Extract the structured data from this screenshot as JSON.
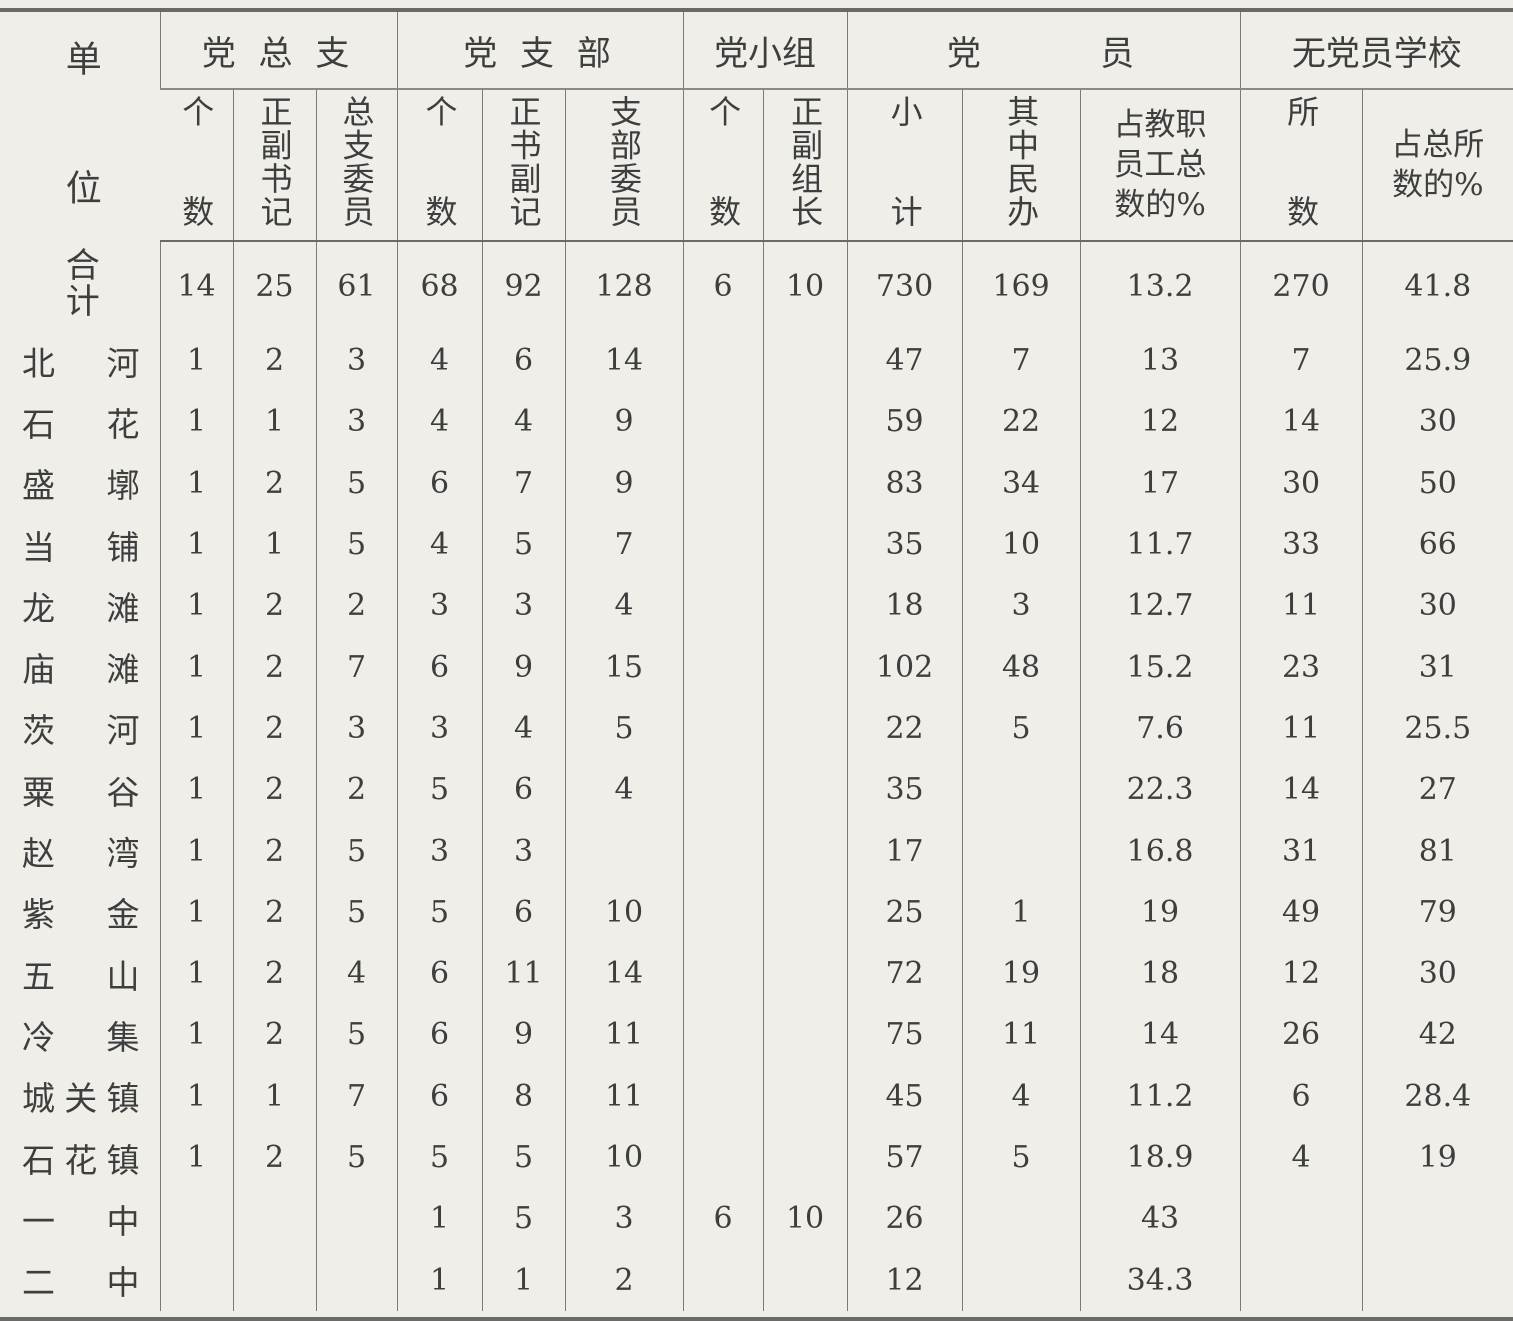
{
  "table": {
    "unit_header": "单位",
    "groups": [
      "党 总 支",
      "党 支 部",
      "党小组",
      "党",
      "员",
      "无党员学校"
    ],
    "subheaders": [
      "个数",
      "正副书记",
      "总支委员",
      "个数",
      "正书副记",
      "支部委员",
      "个数",
      "正副组长",
      "小计",
      "其中民办",
      "占教职\n员工总\n数的%",
      "所数",
      "占总所\n数的%"
    ],
    "total": {
      "name": "合计",
      "values": [
        "14",
        "25",
        "61",
        "68",
        "92",
        "128",
        "6",
        "10",
        "730",
        "169",
        "13.2",
        "270",
        "41.8"
      ]
    },
    "rows": [
      {
        "name": "北河",
        "values": [
          "1",
          "2",
          "3",
          "4",
          "6",
          "14",
          "",
          "",
          "47",
          "7",
          "13",
          "7",
          "25.9"
        ]
      },
      {
        "name": "石花",
        "values": [
          "1",
          "1",
          "3",
          "4",
          "4",
          "9",
          "",
          "",
          "59",
          "22",
          "12",
          "14",
          "30"
        ]
      },
      {
        "name": "盛墎",
        "values": [
          "1",
          "2",
          "5",
          "6",
          "7",
          "9",
          "",
          "",
          "83",
          "34",
          "17",
          "30",
          "50"
        ]
      },
      {
        "name": "当铺",
        "values": [
          "1",
          "1",
          "5",
          "4",
          "5",
          "7",
          "",
          "",
          "35",
          "10",
          "11.7",
          "33",
          "66"
        ]
      },
      {
        "name": "龙滩",
        "values": [
          "1",
          "2",
          "2",
          "3",
          "3",
          "4",
          "",
          "",
          "18",
          "3",
          "12.7",
          "11",
          "30"
        ]
      },
      {
        "name": "庙滩",
        "values": [
          "1",
          "2",
          "7",
          "6",
          "9",
          "15",
          "",
          "",
          "102",
          "48",
          "15.2",
          "23",
          "31"
        ]
      },
      {
        "name": "茨河",
        "values": [
          "1",
          "2",
          "3",
          "3",
          "4",
          "5",
          "",
          "",
          "22",
          "5",
          "7.6",
          "11",
          "25.5"
        ]
      },
      {
        "name": "粟谷",
        "values": [
          "1",
          "2",
          "2",
          "5",
          "6",
          "4",
          "",
          "",
          "35",
          "",
          "22.3",
          "14",
          "27"
        ]
      },
      {
        "name": "赵湾",
        "values": [
          "1",
          "2",
          "5",
          "3",
          "3",
          "",
          "",
          "",
          "17",
          "",
          "16.8",
          "31",
          "81"
        ]
      },
      {
        "name": "紫金",
        "values": [
          "1",
          "2",
          "5",
          "5",
          "6",
          "10",
          "",
          "",
          "25",
          "1",
          "19",
          "49",
          "79"
        ]
      },
      {
        "name": "五山",
        "values": [
          "1",
          "2",
          "4",
          "6",
          "11",
          "14",
          "",
          "",
          "72",
          "19",
          "18",
          "12",
          "30"
        ]
      },
      {
        "name": "冷集",
        "values": [
          "1",
          "2",
          "5",
          "6",
          "9",
          "11",
          "",
          "",
          "75",
          "11",
          "14",
          "26",
          "42"
        ]
      },
      {
        "name": "城关镇",
        "values": [
          "1",
          "1",
          "7",
          "6",
          "8",
          "11",
          "",
          "",
          "45",
          "4",
          "11.2",
          "6",
          "28.4"
        ]
      },
      {
        "name": "石花镇",
        "values": [
          "1",
          "2",
          "5",
          "5",
          "5",
          "10",
          "",
          "",
          "57",
          "5",
          "18.9",
          "4",
          "19"
        ]
      },
      {
        "name": "一中",
        "values": [
          "",
          "",
          "",
          "1",
          "5",
          "3",
          "6",
          "10",
          "26",
          "",
          "43",
          "",
          ""
        ]
      },
      {
        "name": "二中",
        "values": [
          "",
          "",
          "",
          "1",
          "1",
          "2",
          "",
          "",
          "12",
          "",
          "34.3",
          "",
          ""
        ]
      }
    ]
  }
}
